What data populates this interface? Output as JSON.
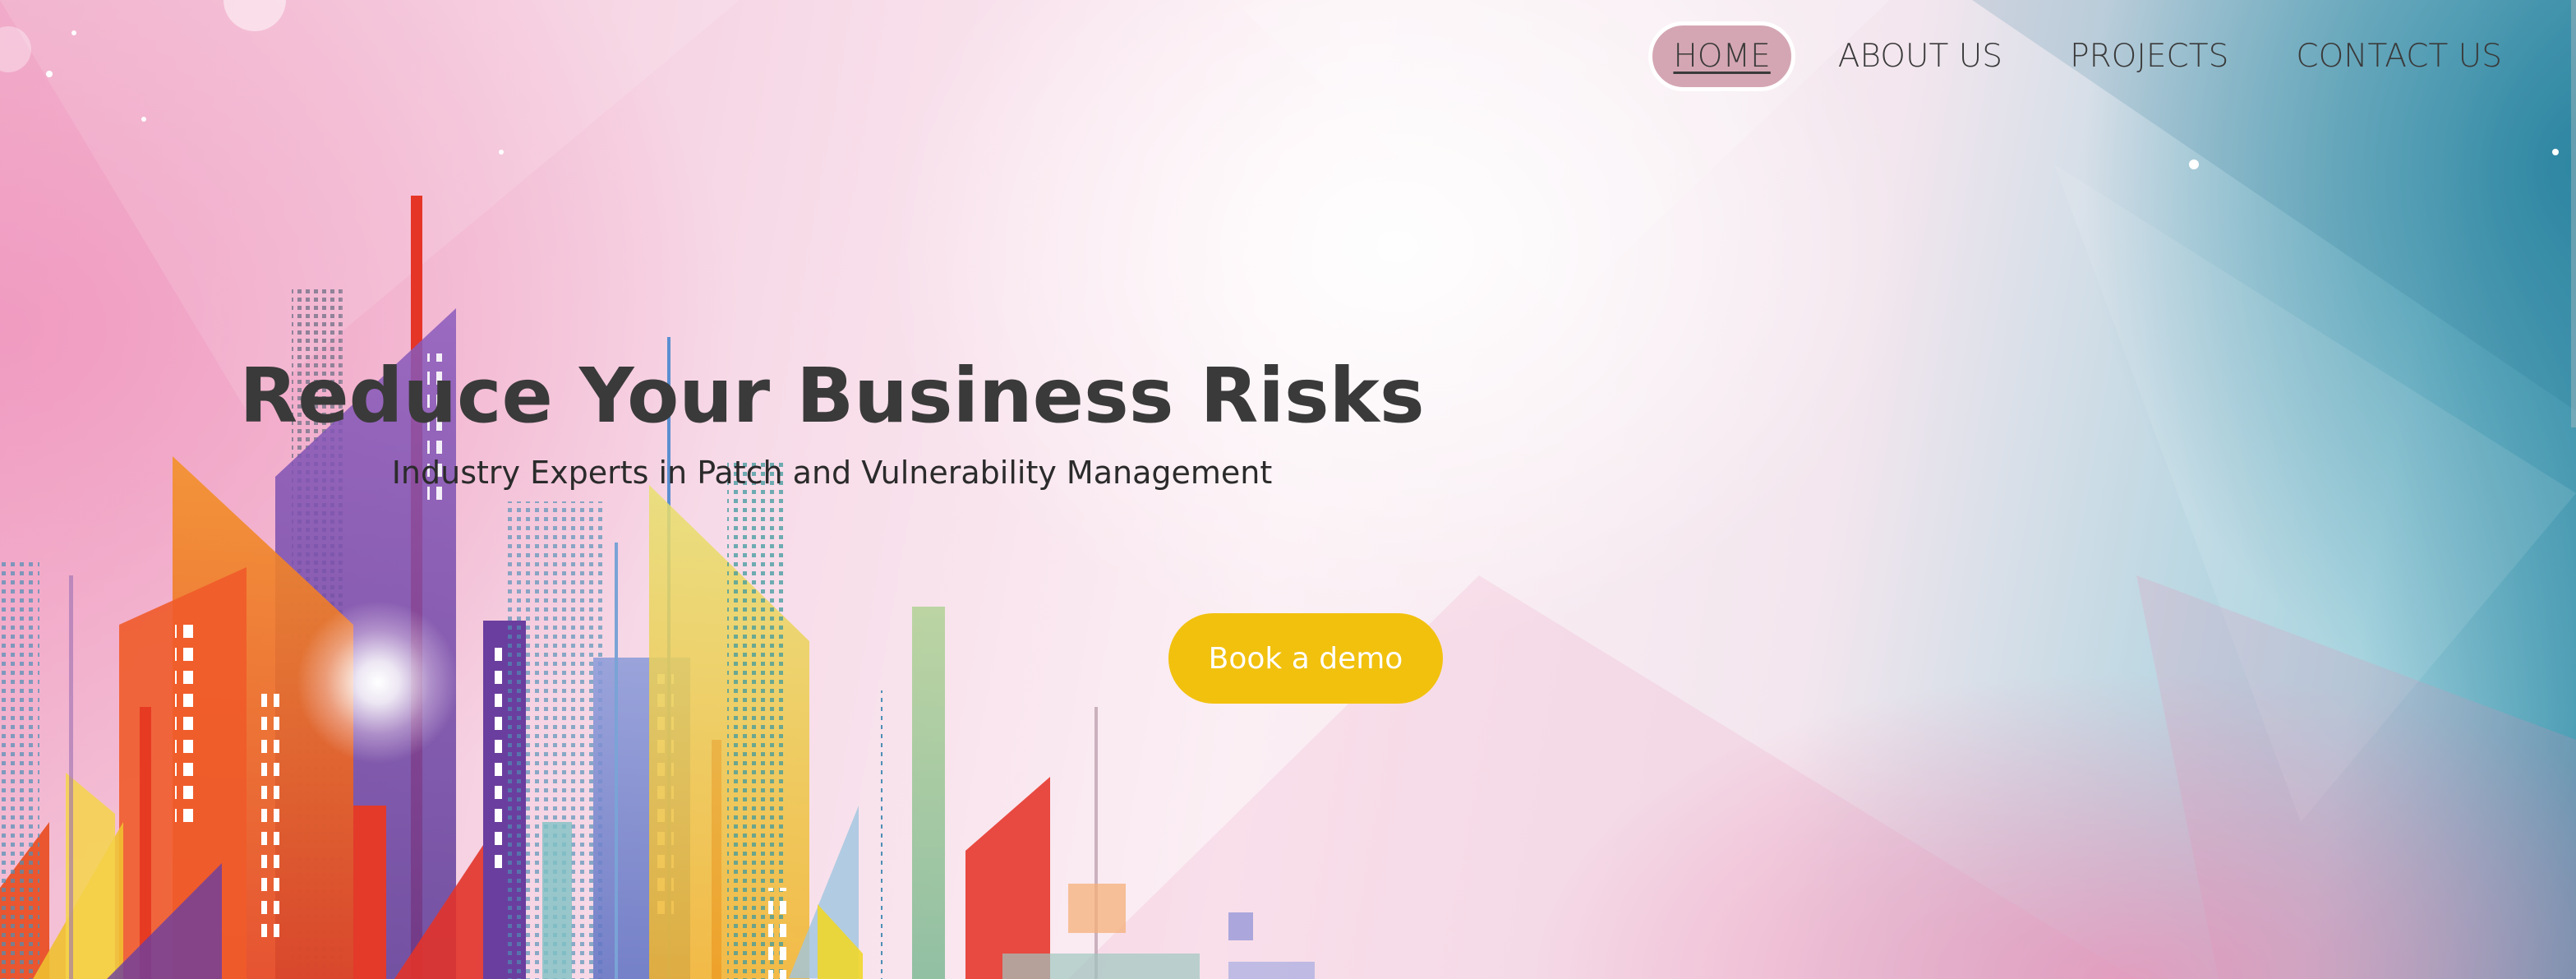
{
  "nav": {
    "items": [
      {
        "label": "HOME",
        "active": true
      },
      {
        "label": "ABOUT US",
        "active": false
      },
      {
        "label": "PROJECTS",
        "active": false
      },
      {
        "label": "CONTACT US",
        "active": false
      }
    ]
  },
  "hero": {
    "headline": "Reduce Your Business Risks",
    "subheadline": "Industry Experts in Patch and Vulnerability Management",
    "cta_label": "Book a demo"
  },
  "colors": {
    "cta_background": "#f2c10e",
    "nav_active_background": "#d4a6b3",
    "text_primary": "#3a3a3a",
    "background_left": "#f2b6cf",
    "background_right": "#3f95ae"
  },
  "background_image": "colorful-city-skyline-illustration"
}
